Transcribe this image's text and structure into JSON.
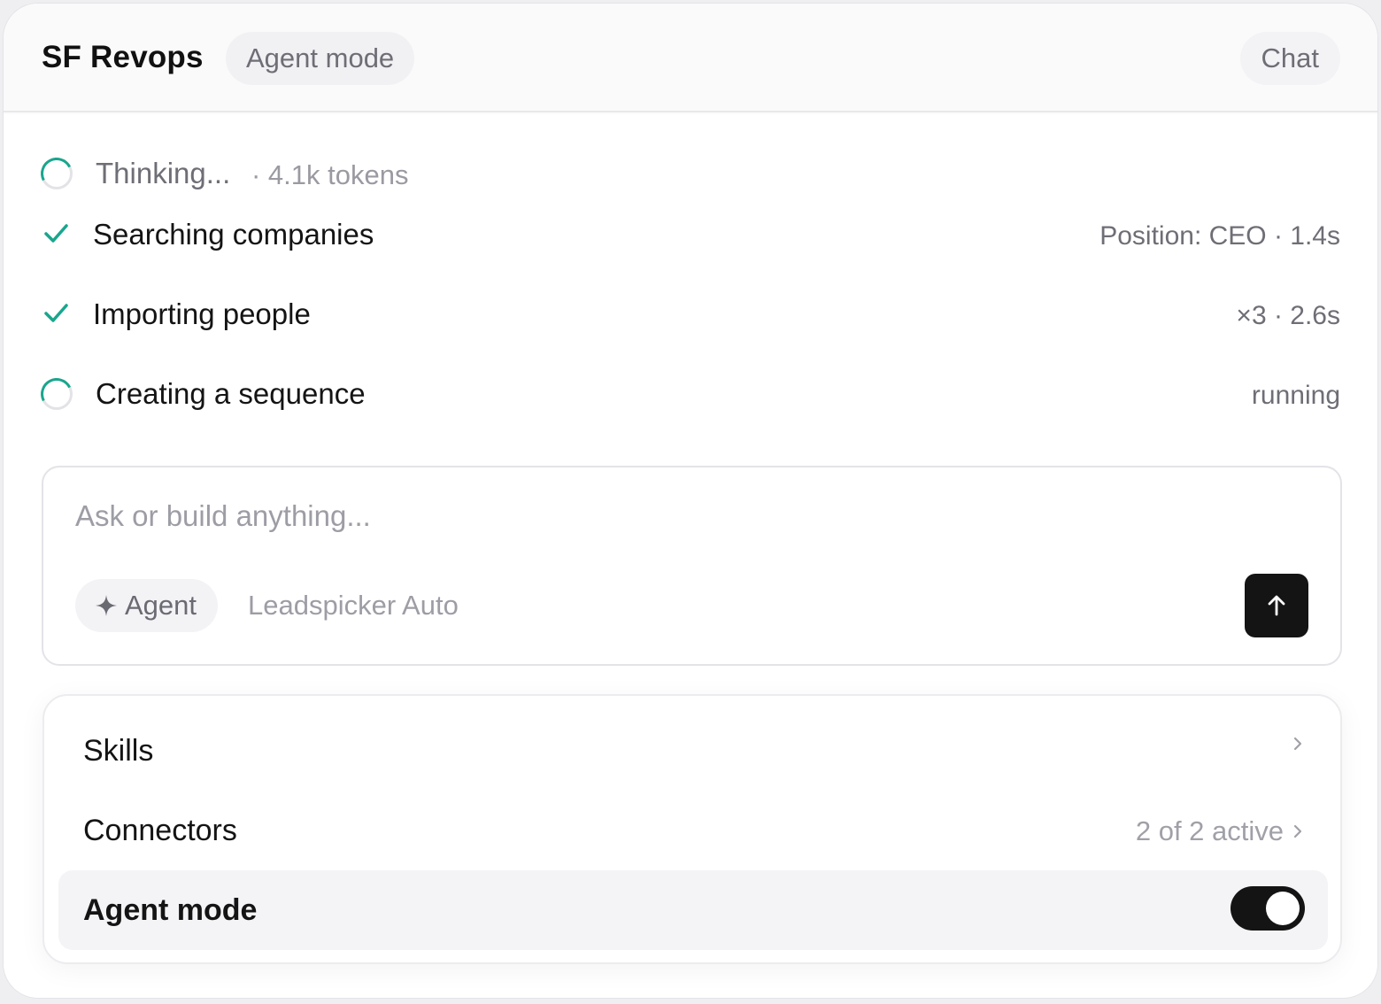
{
  "header": {
    "title": "SF Revops",
    "mode_badge": "Agent mode",
    "chat_label": "Chat"
  },
  "steps": [
    {
      "label": "Thinking...",
      "detail": "· 4.1k tokens",
      "status": "in-progress"
    },
    {
      "label": "Searching companies",
      "meta": "Position: CEO · 1.4s",
      "status": "done"
    },
    {
      "label": "Importing people",
      "meta": "×3 · 2.6s",
      "status": "done"
    },
    {
      "label": "Creating a sequence",
      "meta": "running",
      "status": "in-progress"
    }
  ],
  "composer": {
    "placeholder": "Ask or build anything...",
    "agent_chip": "Agent",
    "model": "Leadspicker Auto",
    "send_icon": "arrow-up-icon"
  },
  "menu": {
    "skills_label": "Skills",
    "connectors_label": "Connectors",
    "connectors_status": "2 of 2 active",
    "agent_mode_label": "Agent mode",
    "agent_mode_on": true
  },
  "colors": {
    "accent": "#19a68d",
    "dark": "#141414",
    "muted": "#9d9da5"
  }
}
